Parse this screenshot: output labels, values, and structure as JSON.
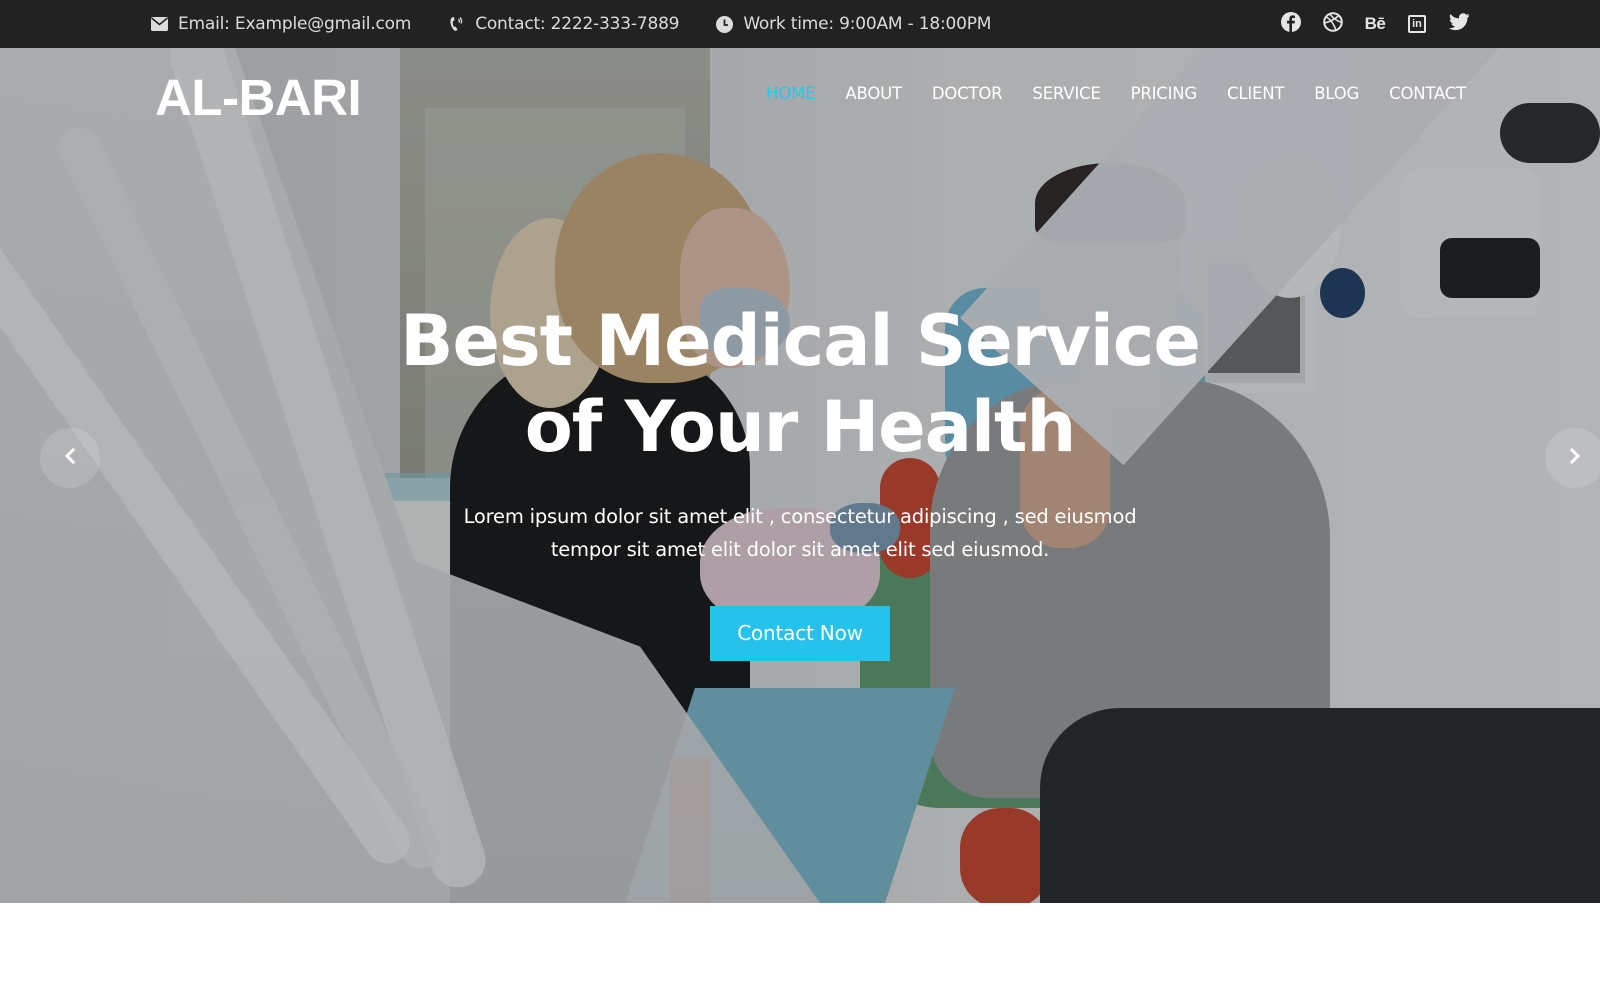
{
  "topbar": {
    "email": {
      "icon": "envelope-icon",
      "text": "Email: Example@gmail.com"
    },
    "phone": {
      "icon": "phone-icon",
      "text": "Contact: 2222-333-7889"
    },
    "hours": {
      "icon": "clock-icon",
      "text": "Work time: 9:00AM - 18:00PM"
    },
    "social": [
      {
        "name": "facebook",
        "icon": "facebook-icon"
      },
      {
        "name": "dribbble",
        "icon": "dribbble-icon"
      },
      {
        "name": "behance",
        "icon": "behance-icon",
        "glyph": "Bē"
      },
      {
        "name": "linkedin",
        "icon": "linkedin-icon",
        "glyph": "in"
      },
      {
        "name": "twitter",
        "icon": "twitter-icon"
      }
    ]
  },
  "header": {
    "logo": "AL-BARI",
    "nav": [
      {
        "label": "HOME",
        "active": true
      },
      {
        "label": "ABOUT",
        "active": false
      },
      {
        "label": "DOCTOR",
        "active": false
      },
      {
        "label": "SERVICE",
        "active": false
      },
      {
        "label": "PRICING",
        "active": false
      },
      {
        "label": "CLIENT",
        "active": false
      },
      {
        "label": "BLOG",
        "active": false
      },
      {
        "label": "CONTACT",
        "active": false
      }
    ]
  },
  "hero": {
    "title_line1": "Best Medical Service",
    "title_line2": "of Your Health",
    "subtitle_line1": "Lorem ipsum dolor sit amet elit , consectetur adipiscing , sed eiusmod",
    "subtitle_line2": "tempor sit amet elit dolor sit amet elit sed eiusmod.",
    "cta_label": "Contact Now",
    "prev_icon": "chevron-left-icon",
    "next_icon": "chevron-right-icon"
  },
  "colors": {
    "accent": "#27c2ec",
    "topbar_bg": "#222222",
    "nav_active": "#2cc4ee"
  }
}
